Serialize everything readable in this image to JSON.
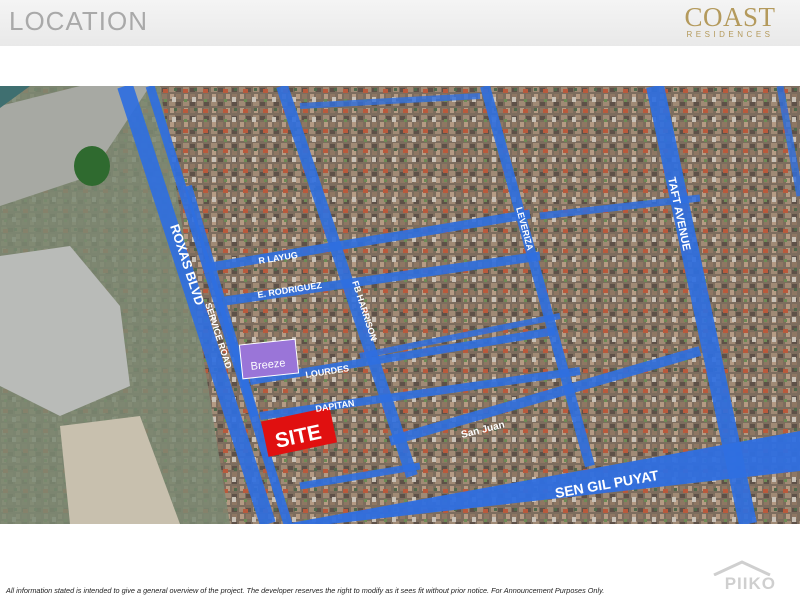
{
  "header": {
    "title": "LOCATION",
    "brand_name": "COAST",
    "brand_sub": "RESIDENCES"
  },
  "map": {
    "roads": {
      "roxas": "ROXAS BLVD",
      "service": "SERVICE ROAD",
      "r_layug": "R LAYUG",
      "e_rodriguez": "E. RODRIGUEZ",
      "fb_harrison": "FB HARRISON",
      "leveriza": "LEVERIZA",
      "taft": "TAFT AVENUE",
      "lourdes": "LOURDES",
      "dapitan": "DAPITAN",
      "san_juan": "San Juan",
      "sen_gil": "SEN GIL PUYAT"
    },
    "breeze_label": "Breeze",
    "site_label": "SITE",
    "colors": {
      "road": "#2f6fe0",
      "site": "#e01010",
      "breeze": "#9a75d8"
    }
  },
  "footer": {
    "disclaimer": "All information stated is intended to give a general overview of the project. The developer reserves the right to modify as it sees fit without prior notice. For Announcement Purposes Only."
  },
  "watermark": {
    "text": "PIIKO"
  }
}
